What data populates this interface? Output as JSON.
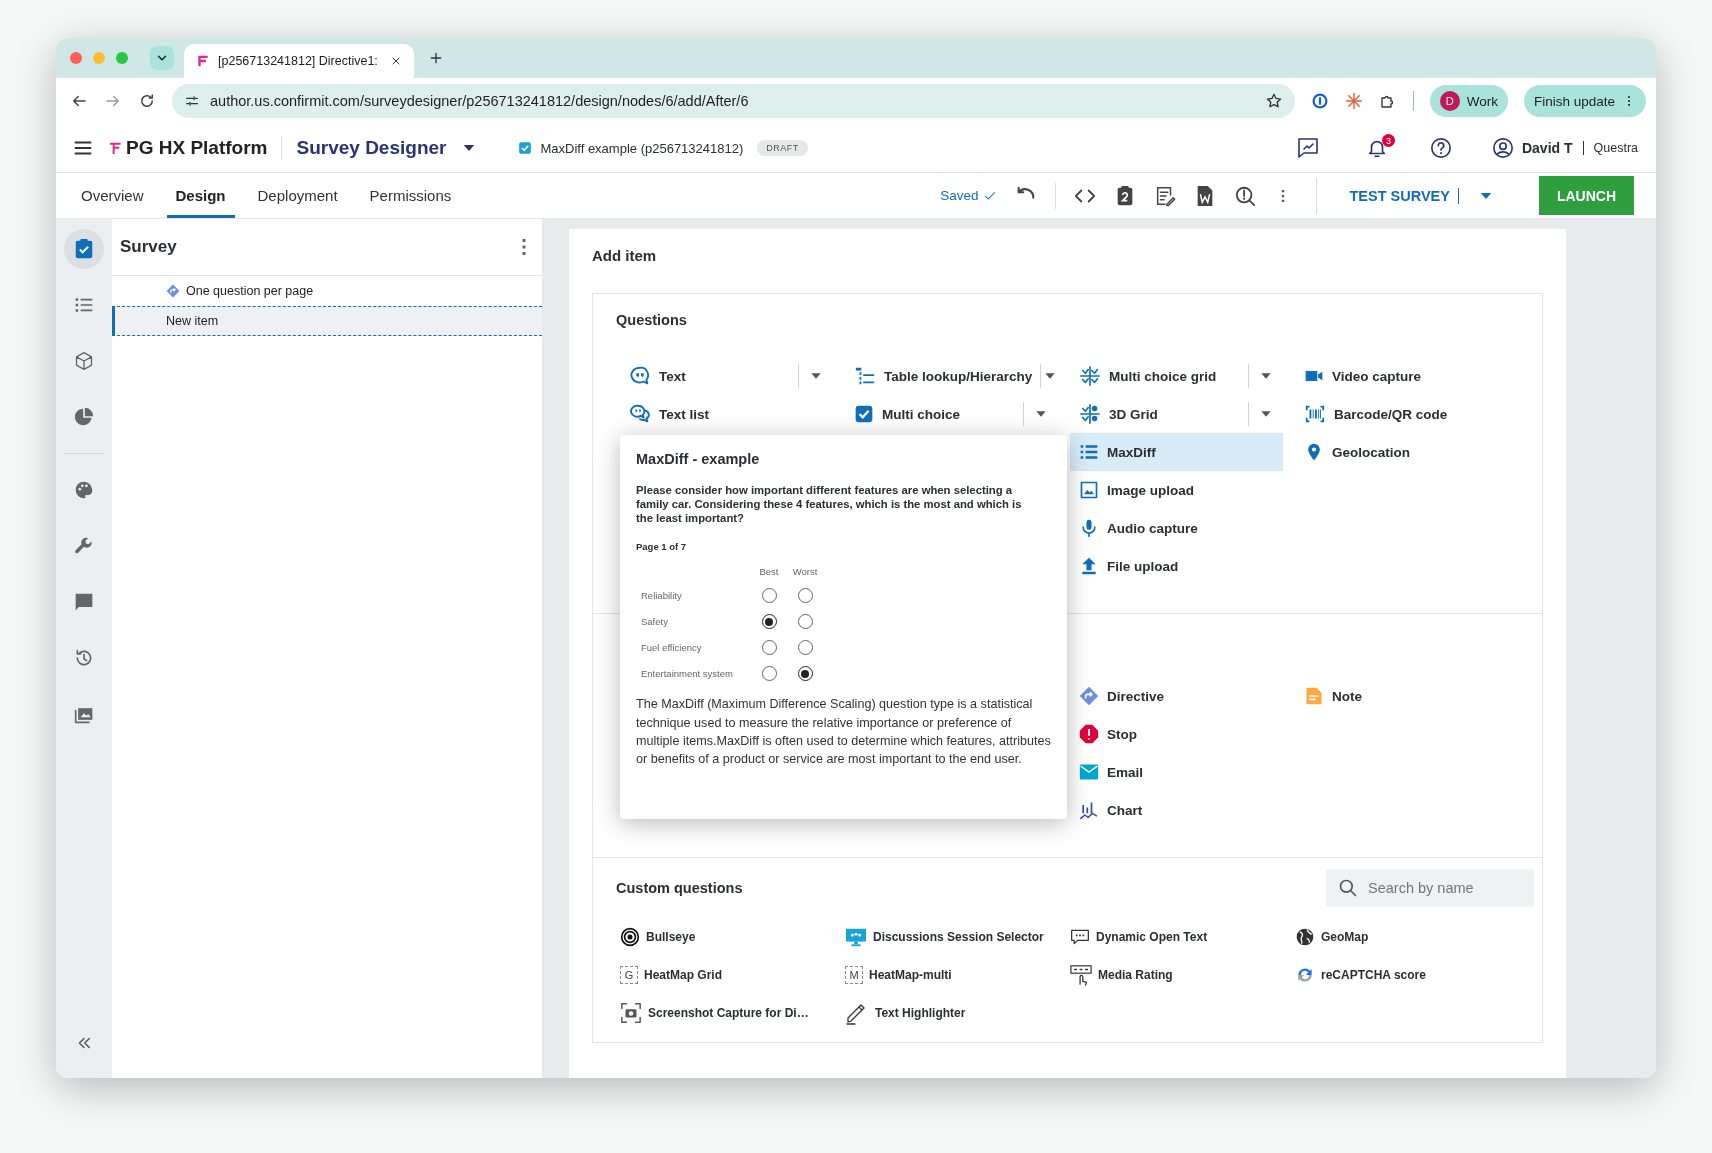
{
  "browser": {
    "tab_title": "[p256713241812] Directive1:",
    "url": "author.us.confirmit.com/surveydesigner/p256713241812/design/nodes/6/add/After/6",
    "profile_initial": "D",
    "profile": "Work",
    "update_button": "Finish update"
  },
  "app_header": {
    "product": "PG HX Platform",
    "module": "Survey Designer",
    "survey_checked": true,
    "survey_name": "MaxDiff example (p256713241812)",
    "status": "DRAFT",
    "notification_count": "3",
    "user": "David T",
    "company": "Questra"
  },
  "nav_tabs": [
    {
      "label": "Overview",
      "selected": false
    },
    {
      "label": "Design",
      "selected": true
    },
    {
      "label": "Deployment",
      "selected": false
    },
    {
      "label": "Permissions",
      "selected": false
    }
  ],
  "toolbar": {
    "save_status": "Saved",
    "test_button": "TEST SURVEY",
    "launch_button": "LAUNCH"
  },
  "rail": [
    {
      "selected": true
    },
    {
      "selected": false
    },
    {
      "selected": false
    },
    {
      "selected": false
    },
    {
      "selected": false
    },
    {
      "selected": false
    },
    {
      "selected": false
    },
    {
      "selected": false
    },
    {
      "selected": false
    }
  ],
  "survey_panel": {
    "title": "Survey",
    "tree": [
      {
        "label": "One question per page",
        "kind": "directive",
        "selected": false
      },
      {
        "label": "New item",
        "kind": "item",
        "selected": true
      }
    ]
  },
  "add_item": {
    "title": "Add item",
    "sections": [
      {
        "title": "Questions",
        "columns": [
          [
            {
              "label": "Text",
              "dropdown": true,
              "selected": false
            },
            {
              "label": "Text list",
              "dropdown": false,
              "selected": false
            }
          ],
          [
            {
              "label": "Table lookup/Hierarchy",
              "dropdown": true,
              "selected": false
            },
            {
              "label": "Multi choice",
              "dropdown": true,
              "selected": false
            }
          ],
          [
            {
              "label": "Multi choice grid",
              "dropdown": true,
              "selected": false
            },
            {
              "label": "3D Grid",
              "dropdown": true,
              "selected": false
            },
            {
              "label": "MaxDiff",
              "dropdown": false,
              "selected": true
            },
            {
              "label": "Image upload",
              "dropdown": false,
              "selected": false
            },
            {
              "label": "Audio capture",
              "dropdown": false,
              "selected": false
            },
            {
              "label": "File upload",
              "dropdown": false,
              "selected": false
            }
          ],
          [
            {
              "label": "Video capture",
              "dropdown": false,
              "selected": false
            },
            {
              "label": "Barcode/QR code",
              "dropdown": false,
              "selected": false
            },
            {
              "label": "Geolocation",
              "dropdown": false,
              "selected": false
            }
          ]
        ]
      },
      {
        "columns": [
          [
            {
              "label": "Directive",
              "dropdown": false,
              "selected": false
            },
            {
              "label": "Stop",
              "dropdown": false,
              "selected": false
            },
            {
              "label": "Email",
              "dropdown": false,
              "selected": false
            },
            {
              "label": "Chart",
              "dropdown": false,
              "selected": false
            }
          ],
          [
            {
              "label": "Note",
              "dropdown": false,
              "selected": false
            }
          ]
        ]
      }
    ],
    "custom": {
      "title": "Custom questions",
      "search": {
        "placeholder": "Search by name"
      },
      "items": [
        {
          "label": "Bullseye"
        },
        {
          "label": "Discussions Session Selector"
        },
        {
          "label": "Dynamic Open Text"
        },
        {
          "label": "GeoMap"
        },
        {
          "label": "HeatMap Grid",
          "icon_letter": "G"
        },
        {
          "label": "HeatMap-multi",
          "icon_letter": "M"
        },
        {
          "label": "Media Rating"
        },
        {
          "label": "reCAPTCHA score"
        },
        {
          "label": "Screenshot Capture for Di…"
        },
        {
          "label": "Text Highlighter"
        }
      ]
    }
  },
  "preview": {
    "title": "MaxDiff - example",
    "question": "Please consider how important different features are when selecting a family car. Considering these 4 features, which is the most and which is the least important?",
    "page": "Page 1 of 7",
    "headers": [
      "Best",
      "Worst"
    ],
    "rows": [
      {
        "label": "Reliability",
        "best": false,
        "worst": false
      },
      {
        "label": "Safety",
        "best": true,
        "worst": false
      },
      {
        "label": "Fuel efficiency",
        "best": false,
        "worst": false
      },
      {
        "label": "Entertainment system",
        "best": false,
        "worst": true
      }
    ],
    "description": "The MaxDiff (Maximum Difference Scaling) question type is a statistical technique used to measure the relative importance or preference of multiple items.MaxDiff is often used to determine which features, attributes or benefits of a product or service are most important to the end user."
  }
}
